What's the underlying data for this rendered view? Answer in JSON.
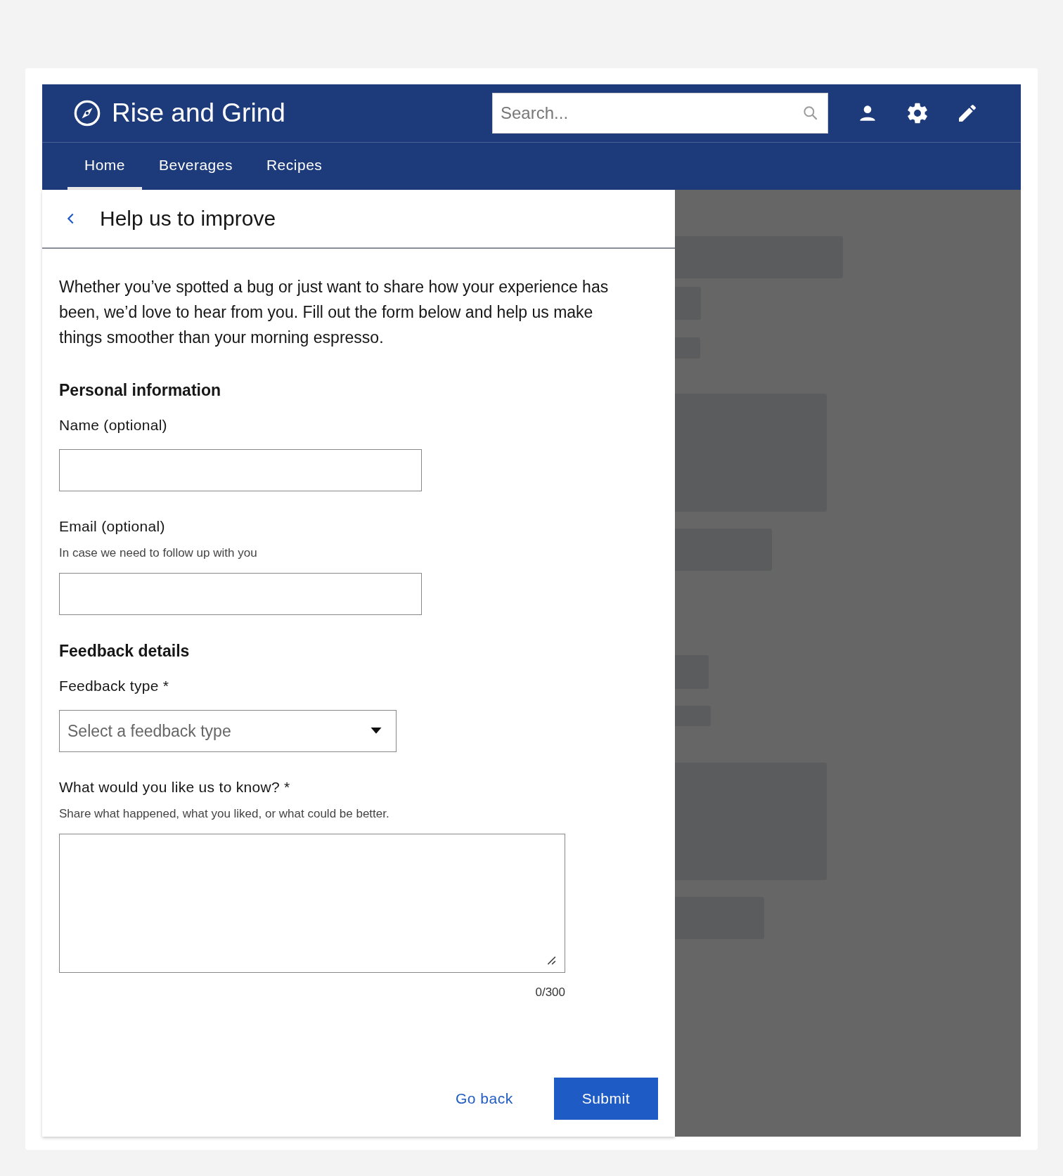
{
  "header": {
    "title": "Rise and Grind",
    "search": {
      "placeholder": "Search..."
    }
  },
  "nav": {
    "tabs": [
      {
        "label": "Home",
        "selected": true
      },
      {
        "label": "Beverages",
        "selected": false
      },
      {
        "label": "Recipes",
        "selected": false
      }
    ]
  },
  "panel": {
    "title": "Help us to improve",
    "intro": "Whether you’ve spotted a bug or just want to share how your experience has been, we’d love to hear from you. Fill out the form below and help us make things smoother than your morning espresso.",
    "sections": [
      {
        "heading": "Personal information",
        "fields": [
          {
            "kind": "text",
            "label": "Name (optional)"
          },
          {
            "kind": "text",
            "label": "Email (optional)",
            "hint": "In case we need to follow up with you"
          }
        ]
      },
      {
        "heading": "Feedback details",
        "fields": [
          {
            "kind": "select",
            "label": "Feedback type *",
            "placeholder": "Select a feedback type"
          },
          {
            "kind": "textarea",
            "label": "What would you like us to know? *",
            "hint": "Share what happened, what you liked, or what could be better.",
            "counter": "0/300"
          }
        ]
      }
    ],
    "actions": [
      {
        "kind": "secondary",
        "label": "Go back"
      },
      {
        "kind": "primary",
        "label": "Submit"
      }
    ]
  }
}
